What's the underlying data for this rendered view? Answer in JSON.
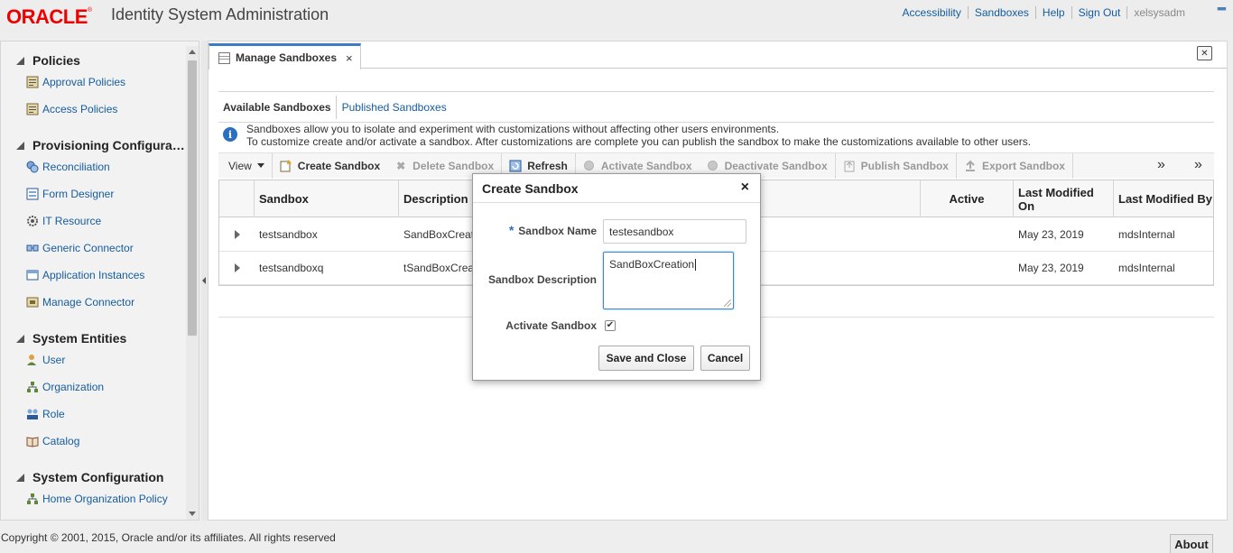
{
  "header": {
    "logo_text": "ORACLE",
    "app_title": "Identity System Administration",
    "nav": [
      "Accessibility",
      "Sandboxes",
      "Help",
      "Sign Out"
    ],
    "user": "xelsysadm"
  },
  "sidebar": {
    "sections": [
      {
        "title": "Policies",
        "items": [
          "Approval Policies",
          "Access Policies"
        ]
      },
      {
        "title": "Provisioning Configura…",
        "items": [
          "Reconciliation",
          "Form Designer",
          "IT Resource",
          "Generic Connector",
          "Application Instances",
          "Manage Connector"
        ]
      },
      {
        "title": "System Entities",
        "items": [
          "User",
          "Organization",
          "Role",
          "Catalog"
        ]
      },
      {
        "title": "System Configuration",
        "items": [
          "Home Organization Policy"
        ]
      }
    ]
  },
  "main": {
    "tab_label": "Manage Sandboxes",
    "tab_close": "×",
    "subtabs": [
      "Available Sandboxes",
      "Published Sandboxes"
    ],
    "info_lines": [
      "Sandboxes allow you to isolate and experiment with customizations without affecting other users environments.",
      "To customize create and/or activate a sandbox. After customizations are complete you can publish the sandbox to make the customizations available to other users."
    ],
    "toolbar": {
      "view": "View",
      "create": "Create Sandbox",
      "delete": "Delete Sandbox",
      "refresh": "Refresh",
      "activate": "Activate Sandbox",
      "deactivate": "Deactivate Sandbox",
      "publish": "Publish Sandbox",
      "export": "Export Sandbox",
      "overflow": "»"
    },
    "table": {
      "columns": [
        "Sandbox",
        "Description",
        "Active",
        "Last Modified On",
        "Last Modified By"
      ],
      "rows": [
        {
          "name": "testsandbox",
          "description": "SandBoxCreation",
          "active": "",
          "modified_on": "May 23, 2019",
          "modified_by": "mdsInternal"
        },
        {
          "name": "testsandboxq",
          "description": "tSandBoxCreation",
          "active": "",
          "modified_on": "May 23, 2019",
          "modified_by": "mdsInternal"
        }
      ]
    }
  },
  "dialog": {
    "title": "Create Sandbox",
    "close": "×",
    "required_marker": "*",
    "name_label": "Sandbox Name",
    "name_value": "testesandbox",
    "description_label": "Sandbox Description",
    "description_value": "SandBoxCreation",
    "activate_label": "Activate Sandbox",
    "activate_checked": true,
    "save_label": "Save and Close",
    "cancel_label": "Cancel"
  },
  "footer": {
    "copyright": "Copyright © 2001, 2015, Oracle and/or its affiliates. All rights reserved",
    "about": "About"
  },
  "colors": {
    "oracle_red": "#ee0000",
    "link_blue": "#145c9e",
    "accent_blue": "#3d7cc4"
  }
}
